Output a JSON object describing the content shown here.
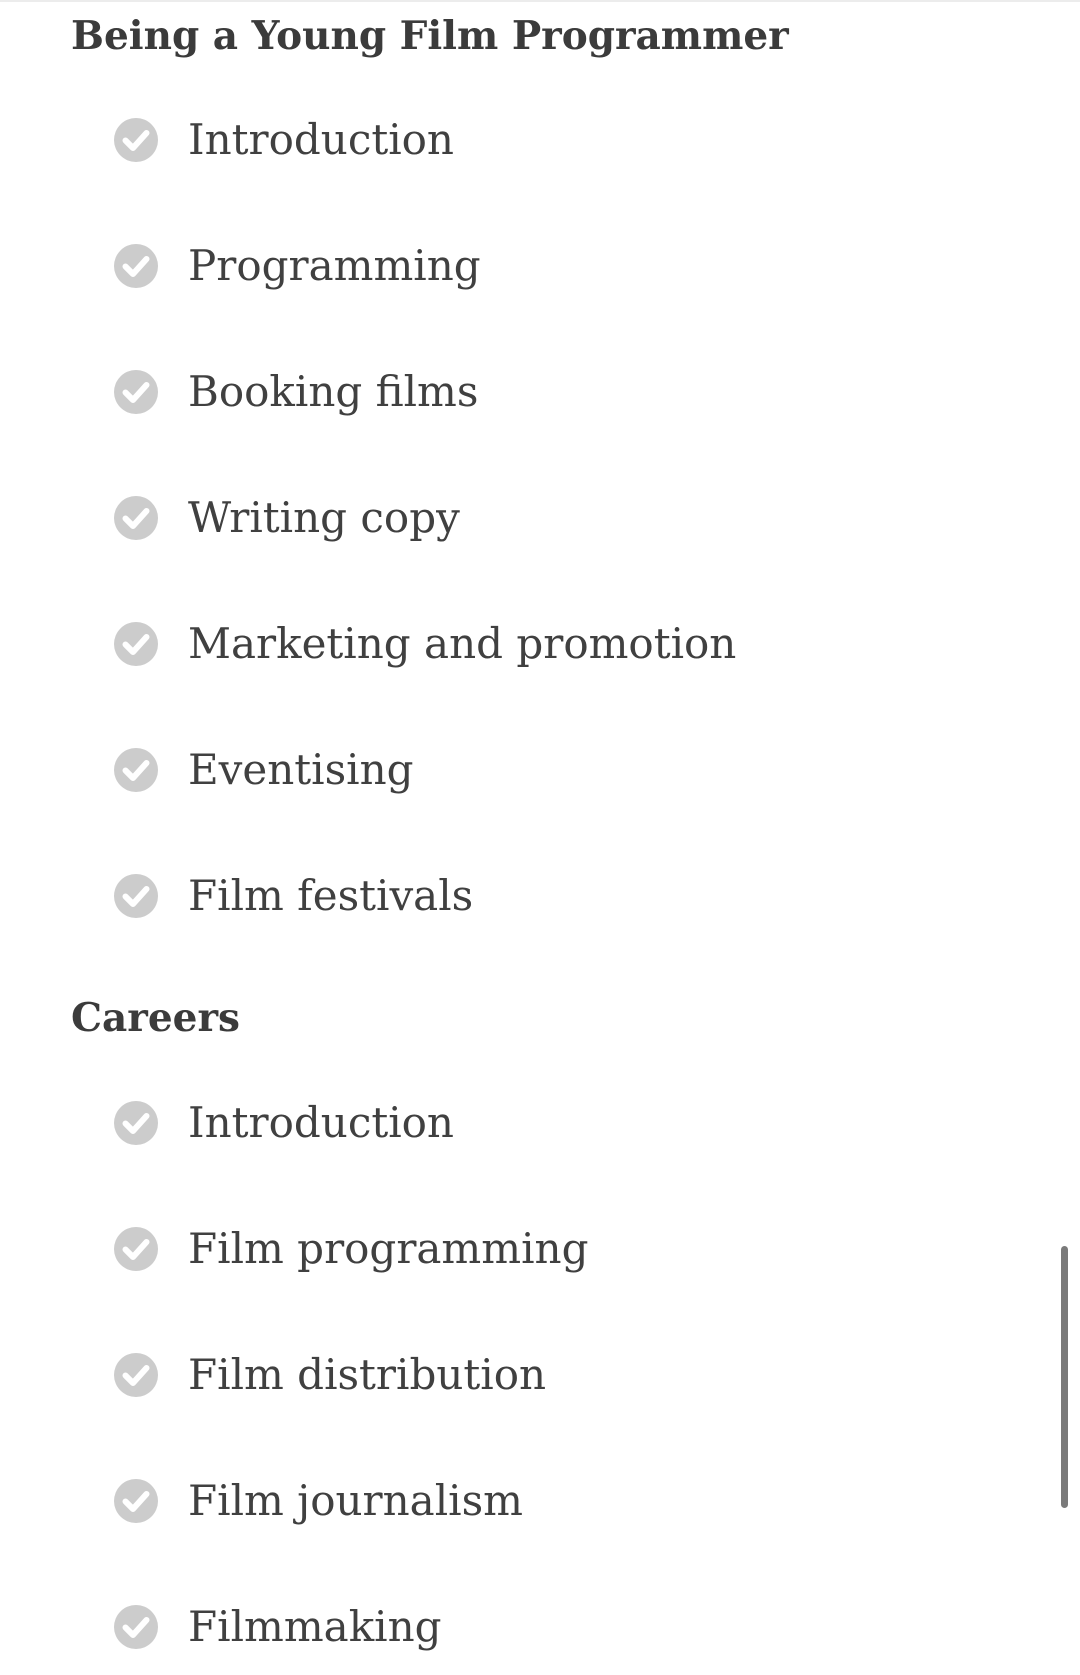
{
  "colors": {
    "check_icon": "#cccccc",
    "text": "#404040",
    "scrollbar": "#7a7a7a"
  },
  "sections": [
    {
      "title": "Being a Young Film Programmer",
      "items": [
        {
          "label": "Introduction",
          "icon": "check-circle-icon"
        },
        {
          "label": "Programming",
          "icon": "check-circle-icon"
        },
        {
          "label": "Booking films",
          "icon": "check-circle-icon"
        },
        {
          "label": "Writing copy",
          "icon": "check-circle-icon"
        },
        {
          "label": "Marketing and promotion",
          "icon": "check-circle-icon"
        },
        {
          "label": "Eventising",
          "icon": "check-circle-icon"
        },
        {
          "label": "Film festivals",
          "icon": "check-circle-icon"
        }
      ]
    },
    {
      "title": "Careers",
      "items": [
        {
          "label": "Introduction",
          "icon": "check-circle-icon"
        },
        {
          "label": "Film programming",
          "icon": "check-circle-icon"
        },
        {
          "label": "Film distribution",
          "icon": "check-circle-icon"
        },
        {
          "label": "Film journalism",
          "icon": "check-circle-icon"
        },
        {
          "label": "Filmmaking",
          "icon": "check-circle-icon"
        }
      ]
    }
  ]
}
